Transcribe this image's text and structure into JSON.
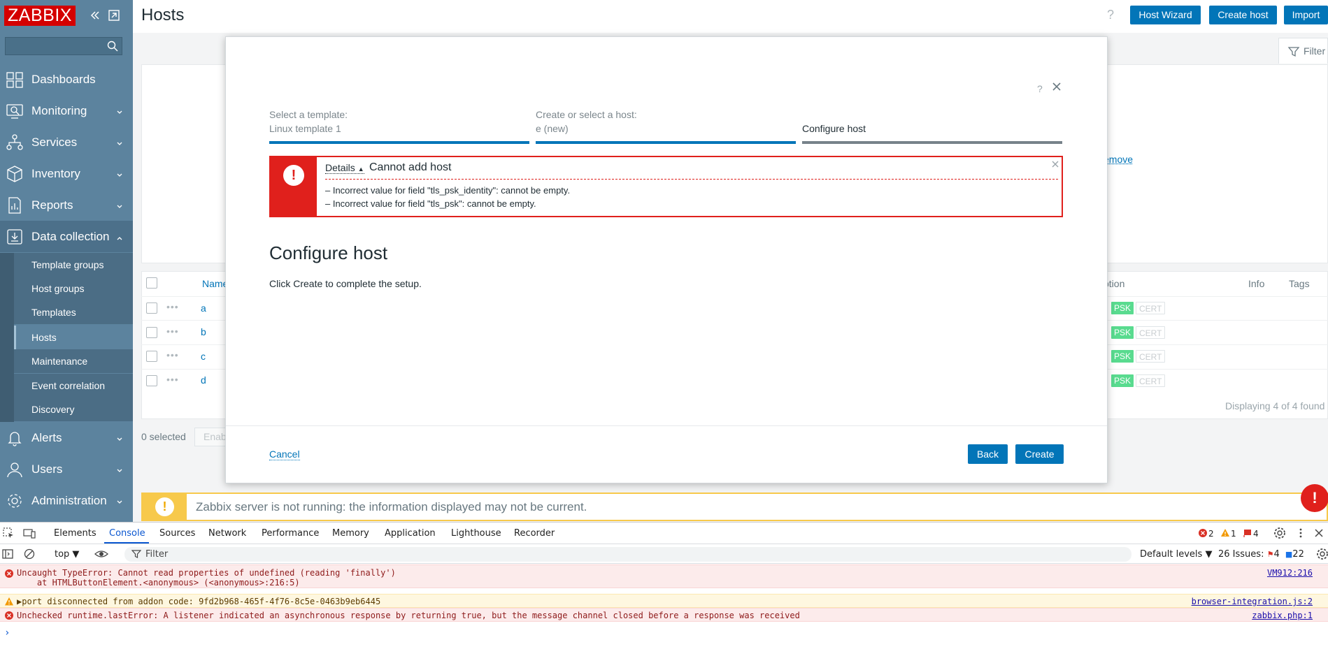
{
  "app": {
    "logo": "ZABBIX",
    "page_title": "Hosts",
    "help": "?",
    "header_buttons": {
      "host_wizard": "Host Wizard",
      "create_host": "Create host",
      "import": "Import"
    },
    "filter_tab": "Filter"
  },
  "sidebar": {
    "search_placeholder": "",
    "items": [
      {
        "label": "Dashboards",
        "icon": "dashboards-icon"
      },
      {
        "label": "Monitoring",
        "icon": "monitoring-icon"
      },
      {
        "label": "Services",
        "icon": "services-icon"
      },
      {
        "label": "Inventory",
        "icon": "inventory-icon"
      },
      {
        "label": "Reports",
        "icon": "reports-icon"
      },
      {
        "label": "Data collection",
        "icon": "data-collection-icon"
      },
      {
        "label": "Alerts",
        "icon": "alerts-icon"
      },
      {
        "label": "Users",
        "icon": "users-icon"
      },
      {
        "label": "Administration",
        "icon": "administration-icon"
      }
    ],
    "submenu": [
      "Template groups",
      "Host groups",
      "Templates",
      "Hosts",
      "Maintenance",
      "Event correlation",
      "Discovery"
    ]
  },
  "background": {
    "remove_link": "emove",
    "table_headers": {
      "name": "Name",
      "option": "ption",
      "info": "Info",
      "tags": "Tags"
    },
    "rows": [
      {
        "name": "a",
        "psk": "PSK",
        "cert": "CERT"
      },
      {
        "name": "b",
        "psk": "PSK",
        "cert": "CERT"
      },
      {
        "name": "c",
        "psk": "PSK",
        "cert": "CERT"
      },
      {
        "name": "d",
        "psk": "PSK",
        "cert": "CERT"
      }
    ],
    "displaying": "Displaying 4 of 4 found",
    "selected": "0 selected",
    "enable_btn": "Enab",
    "warning": "Zabbix server is not running: the information displayed may not be current."
  },
  "modal": {
    "help": "?",
    "steps": [
      {
        "label": "Select a template:",
        "value": "Linux template 1"
      },
      {
        "label": "Create or select a host:",
        "value": "e (new)"
      },
      {
        "label": "",
        "value": "Configure host"
      }
    ],
    "error": {
      "details": "Details",
      "title": "Cannot add host",
      "lines": [
        "–  Incorrect value for field \"tls_psk_identity\": cannot be empty.",
        "–  Incorrect value for field \"tls_psk\": cannot be empty."
      ]
    },
    "title": "Configure host",
    "subtitle": "Click Create to complete the setup.",
    "cancel": "Cancel",
    "back": "Back",
    "create": "Create"
  },
  "devtools": {
    "tabs": [
      "Elements",
      "Console",
      "Sources",
      "Network",
      "Performance",
      "Memory",
      "Application",
      "Lighthouse",
      "Recorder"
    ],
    "active_tab": "Console",
    "counts": {
      "errors": "2",
      "warnings": "1",
      "issues_flag": "4"
    },
    "context": "top ▼",
    "filter": "Filter",
    "levels": "Default levels ▼",
    "issues_label": "26 Issues:",
    "issues_red": "4",
    "issues_blue": "22",
    "logs": [
      {
        "type": "error",
        "text": "Uncaught TypeError: Cannot read properties of undefined (reading 'finally')\n    at HTMLButtonElement.<anonymous> (<anonymous>:216:5)",
        "source": "VM912:216"
      },
      {
        "type": "warning",
        "text": "▶port disconnected from addon code: 9fd2b968-465f-4f76-8c5e-0463b9eb6445",
        "source": "browser-integration.js:2"
      },
      {
        "type": "error",
        "text": "Unchecked runtime.lastError: A listener indicated an asynchronous response by returning true, but the message channel closed before a response was received",
        "source": "zabbix.php:1"
      }
    ],
    "prompt": "›"
  },
  "colors": {
    "sidebar": "#5c839e",
    "brand_red": "#d40000",
    "primary": "#0275b8",
    "error": "#e0201c",
    "warning": "#f7c94b",
    "psk": "#59db8f"
  }
}
